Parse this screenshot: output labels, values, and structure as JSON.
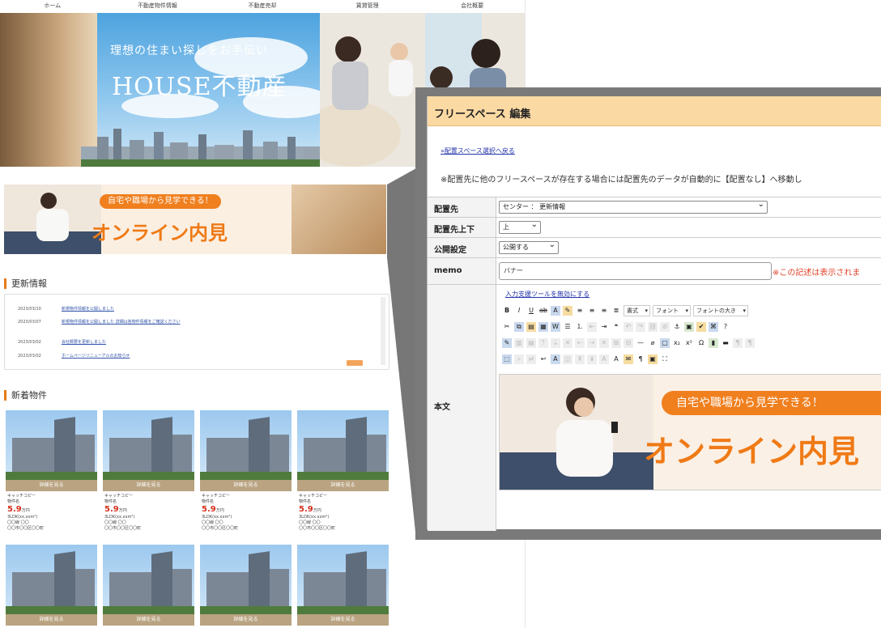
{
  "site": {
    "nav": [
      "ホーム",
      "不動産物件情報",
      "不動産売却",
      "賃貸管理",
      "会社概要"
    ],
    "hero": {
      "subtitle": "理想の住まい探しをお手伝い",
      "title": "HOUSE不動産"
    },
    "banner": {
      "pill": "自宅や職場から見学できる！",
      "headline": "オンライン内見"
    },
    "news": {
      "title": "更新情報",
      "items": [
        {
          "date": "2023/03/10",
          "text": "新規物件情報を公開しました"
        },
        {
          "date": "2023/03/07",
          "text": "新規物件情報を公開しました 詳細は各物件情報をご確認ください"
        },
        {
          "date": "2023/03/02",
          "text": "会社概要を更新しました"
        },
        {
          "date": "2023/03/02",
          "text": "ホームページリニューアルのお知らせ"
        }
      ]
    },
    "listings": {
      "title": "新着物件",
      "button": "詳細を見る",
      "catch": "キャッチコピー",
      "name": "物件名",
      "price": "5.9",
      "price_unit": "万円",
      "layout": "3LDK(xx.xxm²)",
      "loc1": "〇〇線 〇〇",
      "loc2": "〇〇市〇〇区〇〇町"
    }
  },
  "editor": {
    "title": "フリースペース 編集",
    "back_link": "»配置スペース選択へ戻る",
    "notice": "※配置先に他のフリースペースが存在する場合には配置先のデータが自動的に【配置なし】へ移動し",
    "fields": {
      "placement_label": "配置先",
      "placement_value": "センター ： 更新情報",
      "order_label": "配置先上下",
      "order_value": "上",
      "publish_label": "公開設定",
      "publish_value": "公開する",
      "memo_label": "memo",
      "memo_value": "バナー",
      "memo_note": "※この記述は表示されま",
      "body_label": "本文",
      "tool_link": "入力支援ツールを無効にする"
    },
    "toolbar": {
      "style_select": "書式",
      "font_select": "フォント",
      "size_select": "フォントの大き"
    },
    "banner": {
      "pill": "自宅や職場から見学できる！",
      "headline": "オンライン内見"
    }
  }
}
